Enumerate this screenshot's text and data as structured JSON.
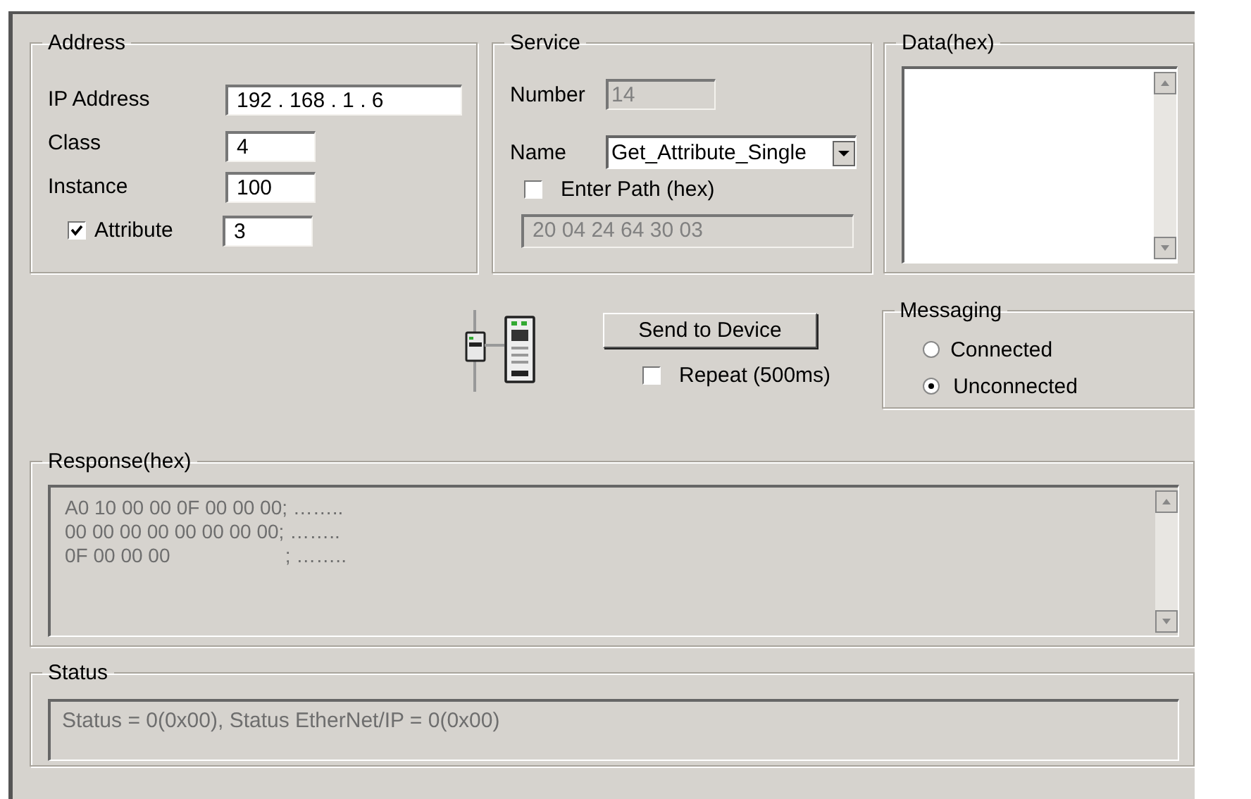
{
  "address": {
    "title": "Address",
    "fields": [
      {
        "kind": "plain",
        "label": "IP Address",
        "value": "192 . 168 . 1 . 6"
      },
      {
        "kind": "plain",
        "label": "Class",
        "value": "4"
      },
      {
        "kind": "plain",
        "label": "Instance",
        "value": "100"
      },
      {
        "kind": "checkbox",
        "label": "Attribute",
        "value": "3",
        "checked": true
      }
    ]
  },
  "service": {
    "title": "Service",
    "number": {
      "label": "Number",
      "value": "14",
      "disabled": true
    },
    "name": {
      "label": "Name",
      "value": "Get_Attribute_Single"
    },
    "enter_path": {
      "label": "Enter Path (hex)",
      "checked": false
    },
    "path": {
      "value": "20 04 24 64 30 03",
      "disabled": true
    }
  },
  "data": {
    "title": "Data(hex)"
  },
  "send_button": "Send to Device",
  "repeat": {
    "label": "Repeat (500ms)",
    "checked": false
  },
  "messaging": {
    "title": "Messaging",
    "options": [
      {
        "label": "Connected",
        "selected": false
      },
      {
        "label": "Unconnected",
        "selected": true
      }
    ]
  },
  "response": {
    "title": "Response(hex)",
    "lines": [
      "A0 10 00 00 0F 00 00 00; ……..",
      "00 00 00 00 00 00 00 00; ……..",
      "0F 00 00 00                     ; …….."
    ]
  },
  "status": {
    "title": "Status",
    "text": "Status = 0(0x00), Status EtherNet/IP = 0(0x00)"
  }
}
